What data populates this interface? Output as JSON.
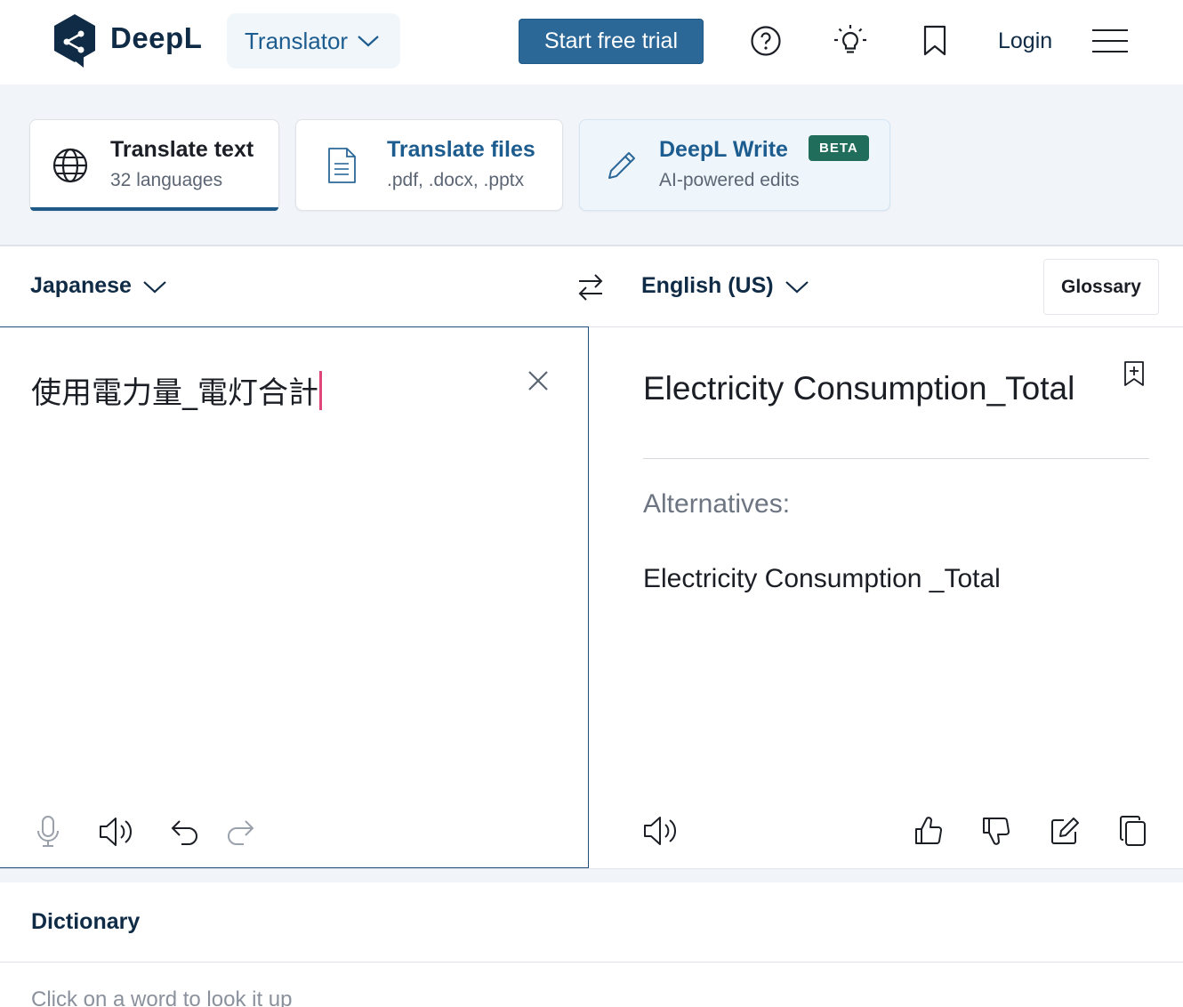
{
  "header": {
    "brand": "DeepL",
    "translator_label": "Translator",
    "trial_label": "Start free trial",
    "login_label": "Login"
  },
  "modes": {
    "text": {
      "title": "Translate text",
      "subtitle": "32 languages"
    },
    "files": {
      "title": "Translate files",
      "subtitle": ".pdf, .docx, .pptx"
    },
    "write": {
      "title": "DeepL Write",
      "badge": "BETA",
      "subtitle": "AI-powered edits"
    }
  },
  "languages": {
    "source": "Japanese",
    "target": "English (US)",
    "glossary_label": "Glossary"
  },
  "source": {
    "text": "使用電力量_電灯合計"
  },
  "target": {
    "text": "Electricity Consumption_Total",
    "alternatives_label": "Alternatives:",
    "alternatives": [
      "Electricity Consumption _Total"
    ]
  },
  "dictionary": {
    "title": "Dictionary",
    "hint": "Click on a word to look it up"
  },
  "colors": {
    "brand": "#0f2b46",
    "accent": "#2b6797",
    "beta": "#216d5c",
    "caret": "#e0457b"
  }
}
